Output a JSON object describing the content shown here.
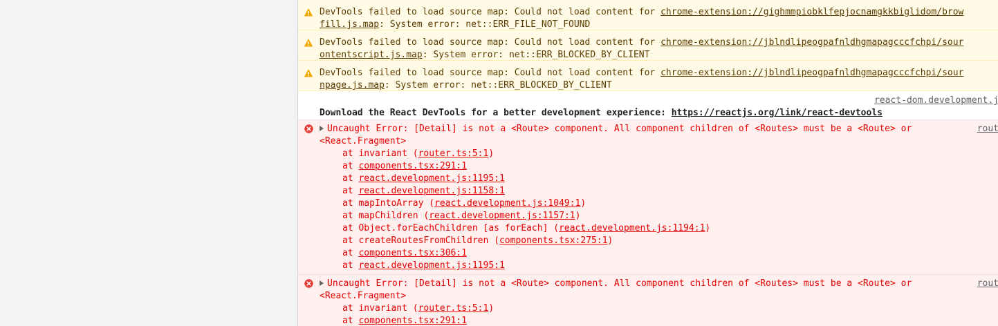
{
  "warnings": [
    {
      "prefix": "DevTools failed to load source map: Could not load content for ",
      "url_part1": "chrome-extension://gighmmpiobklfepjocnamgkkbiglidom/brow",
      "url_part2": "fill.js.map",
      "suffix": ": System error: net::ERR_FILE_NOT_FOUND"
    },
    {
      "prefix": "DevTools failed to load source map: Could not load content for ",
      "url_part1": "chrome-extension://jblndlipeogpafnldhgmapagcccfchpi/sour",
      "url_part2": "ontentscript.js.map",
      "suffix": ": System error: net::ERR_BLOCKED_BY_CLIENT"
    },
    {
      "prefix": "DevTools failed to load source map: Could not load content for ",
      "url_part1": "chrome-extension://jblndlipeogpafnldhgmapagcccfchpi/sour",
      "url_part2": "npage.js.map",
      "suffix": ": System error: net::ERR_BLOCKED_BY_CLIENT"
    }
  ],
  "info": {
    "source": "react-dom.development.j",
    "text": "Download the React DevTools for a better development experience: ",
    "link": "https://reactjs.org/link/react-devtools"
  },
  "errors": [
    {
      "message_line1": "Uncaught Error: [Detail] is not a <Route> component. All component children of <Routes> must be a <Route> or",
      "message_line2": "<React.Fragment>",
      "source": "rout",
      "stack": [
        {
          "at": "at invariant (",
          "link": "router.ts:5:1",
          "close": ")"
        },
        {
          "at": "at ",
          "link": "components.tsx:291:1",
          "close": ""
        },
        {
          "at": "at ",
          "link": "react.development.js:1195:1",
          "close": ""
        },
        {
          "at": "at ",
          "link": "react.development.js:1158:1",
          "close": ""
        },
        {
          "at": "at mapIntoArray (",
          "link": "react.development.js:1049:1",
          "close": ")"
        },
        {
          "at": "at mapChildren (",
          "link": "react.development.js:1157:1",
          "close": ")"
        },
        {
          "at": "at Object.forEachChildren [as forEach] (",
          "link": "react.development.js:1194:1",
          "close": ")"
        },
        {
          "at": "at createRoutesFromChildren (",
          "link": "components.tsx:275:1",
          "close": ")"
        },
        {
          "at": "at ",
          "link": "components.tsx:306:1",
          "close": ""
        },
        {
          "at": "at ",
          "link": "react.development.js:1195:1",
          "close": ""
        }
      ]
    },
    {
      "message_line1": "Uncaught Error: [Detail] is not a <Route> component. All component children of <Routes> must be a <Route> or",
      "message_line2": "<React.Fragment>",
      "source": "rout",
      "stack": [
        {
          "at": "at invariant (",
          "link": "router.ts:5:1",
          "close": ")"
        },
        {
          "at": "at ",
          "link": "components.tsx:291:1",
          "close": ""
        }
      ]
    }
  ],
  "colors": {
    "warning_bg": "#fffbe6",
    "warning_text": "#5c3c00",
    "warning_icon": "#f2a600",
    "error_bg": "#fff0f0",
    "error_text": "#e40000",
    "error_icon": "#e53935"
  },
  "icons": {
    "warning": "warning-triangle-icon",
    "error": "error-circle-icon",
    "expand": "expand-triangle-icon"
  }
}
